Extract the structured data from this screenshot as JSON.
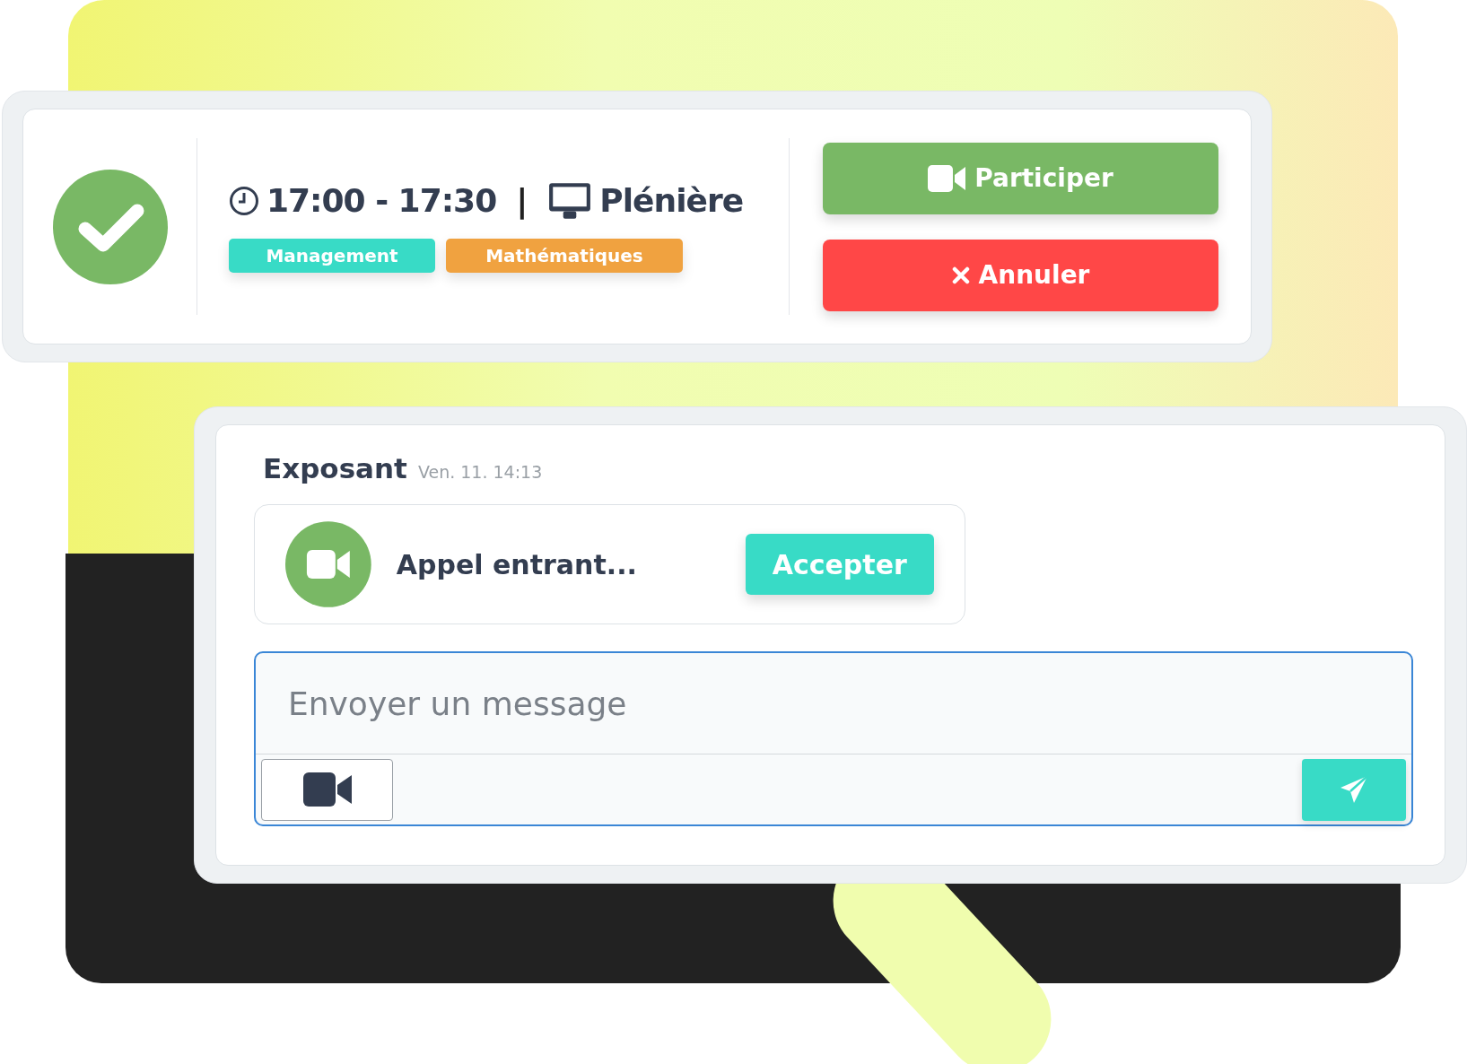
{
  "session": {
    "time": "17:00 - 17:30",
    "separator": "|",
    "room": "Plénière",
    "tags": [
      {
        "label": "Management",
        "color": "#38dbc6"
      },
      {
        "label": "Mathématiques",
        "color": "#f0a240"
      }
    ],
    "buttons": [
      {
        "kind": "join",
        "label": "Participer"
      },
      {
        "kind": "cancel",
        "label": "Annuler"
      }
    ]
  },
  "chat": {
    "sender": "Exposant",
    "timestamp": "Ven. 11. 14:13",
    "call": {
      "text": "Appel entrant...",
      "button": "Accepter"
    },
    "composer": {
      "placeholder": "Envoyer un message"
    }
  }
}
